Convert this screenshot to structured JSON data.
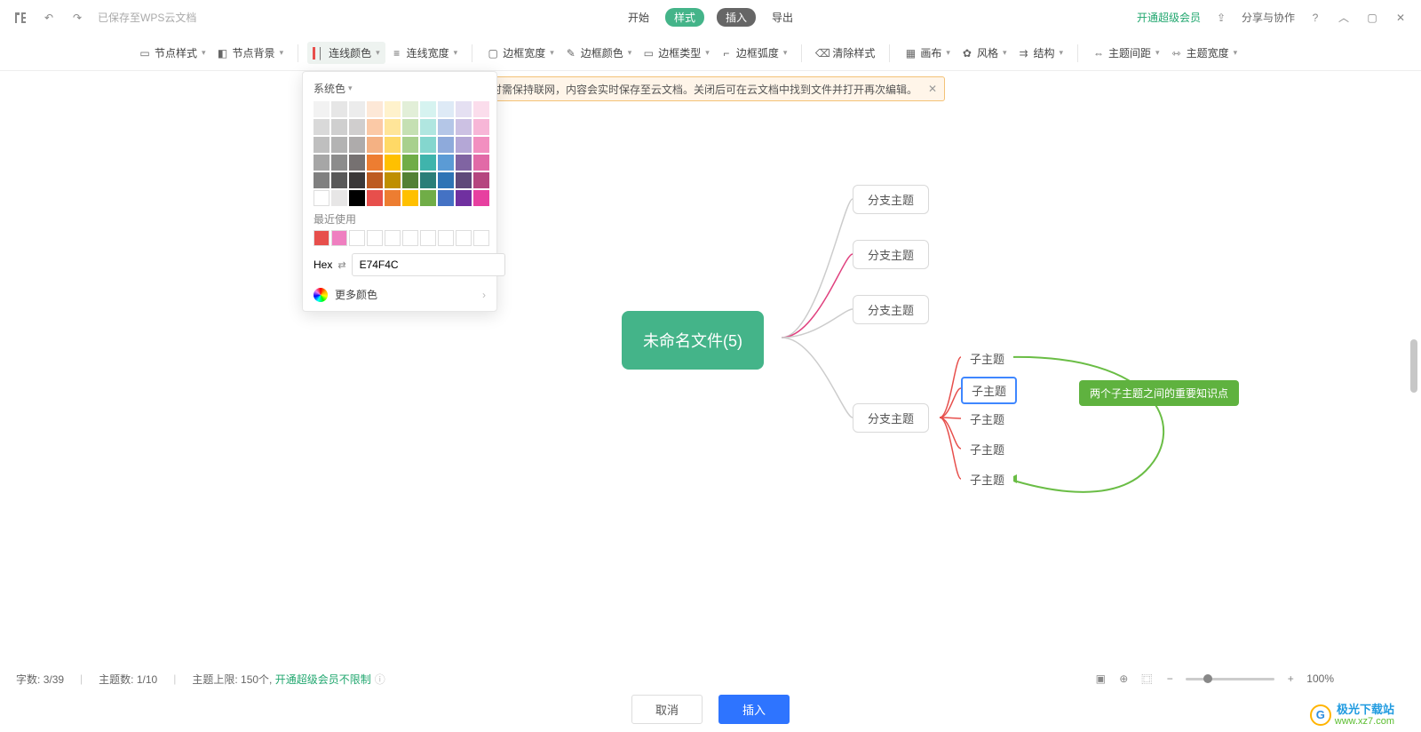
{
  "topbar": {
    "saved_text": "已保存至WPS云文档",
    "tabs": {
      "start": "开始",
      "style": "样式",
      "insert": "插入",
      "export": "导出"
    },
    "vip": "开通超级会员",
    "share": "分享与协作"
  },
  "toolbar": {
    "node_style": "节点样式",
    "node_bg": "节点背景",
    "line_color": "连线颜色",
    "line_width": "连线宽度",
    "border_width": "边框宽度",
    "border_color": "边框颜色",
    "border_type": "边框类型",
    "border_radius": "边框弧度",
    "clear_style": "清除样式",
    "canvas": "画布",
    "style": "风格",
    "structure": "结构",
    "topic_spacing": "主题间距",
    "topic_width": "主题宽度"
  },
  "banner": {
    "text": "时需保持联网，内容会实时保存至云文档。关闭后可在云文档中找到文件并打开再次编辑。"
  },
  "picker": {
    "system_colors": "系统色",
    "swatches": [
      "#f2f2f2",
      "#e6e6e6",
      "#ececec",
      "#fde8d7",
      "#fff2cc",
      "#e2efd8",
      "#d6f3f0",
      "#deeaf6",
      "#e5e0f2",
      "#fbddec",
      "#d9d9d9",
      "#cfcfcf",
      "#d0cece",
      "#fbc9a6",
      "#ffe599",
      "#c5e0b3",
      "#b0e6e0",
      "#b4c6e7",
      "#ccc1e3",
      "#f7b6d7",
      "#bfbfbf",
      "#b3b3b3",
      "#aeabab",
      "#f4b183",
      "#ffd966",
      "#a8d08d",
      "#84d6ce",
      "#8eaadb",
      "#b4a7d6",
      "#f28fc0",
      "#a6a6a6",
      "#8c8c8c",
      "#767171",
      "#ed7d31",
      "#ffc000",
      "#70ad47",
      "#3fb4ac",
      "#5b9bd5",
      "#8064a2",
      "#e16aa7",
      "#808080",
      "#595959",
      "#3b3838",
      "#bd5b20",
      "#bf8f00",
      "#538135",
      "#2a7e78",
      "#2e74b5",
      "#5f497a",
      "#b5467f",
      "#ffffff",
      "#e7e6e6",
      "#000000",
      "#e74f4c",
      "#ed7d31",
      "#ffc000",
      "#70ad47",
      "#4472c4",
      "#7030a0",
      "#e740a0"
    ],
    "recent_label": "最近使用",
    "recent": [
      "#e74f4c",
      "#ef7fc0",
      "#ffffff",
      "#ffffff",
      "#ffffff",
      "#ffffff",
      "#ffffff",
      "#ffffff",
      "#ffffff",
      "#ffffff"
    ],
    "hex_label": "Hex",
    "hex_value": "E74F4C",
    "more_colors": "更多颜色"
  },
  "mindmap": {
    "root": "未命名文件(5)",
    "branches": [
      "分支主题",
      "分支主题",
      "分支主题",
      "分支主题"
    ],
    "subs": [
      "子主题",
      "子主题",
      "子主题",
      "子主题",
      "子主题"
    ],
    "callout": "两个子主题之间的重要知识点"
  },
  "status": {
    "words_label": "字数:",
    "words_value": "3/39",
    "topics_label": "主题数:",
    "topics_value": "1/10",
    "limit_label": "主题上限:",
    "limit_value": "150个,",
    "unlimit": "开通超级会员不限制",
    "zoom": "100%"
  },
  "bottom": {
    "cancel": "取消",
    "insert": "插入"
  },
  "watermark": {
    "site": "极光下载站",
    "url": "www.xz7.com"
  }
}
